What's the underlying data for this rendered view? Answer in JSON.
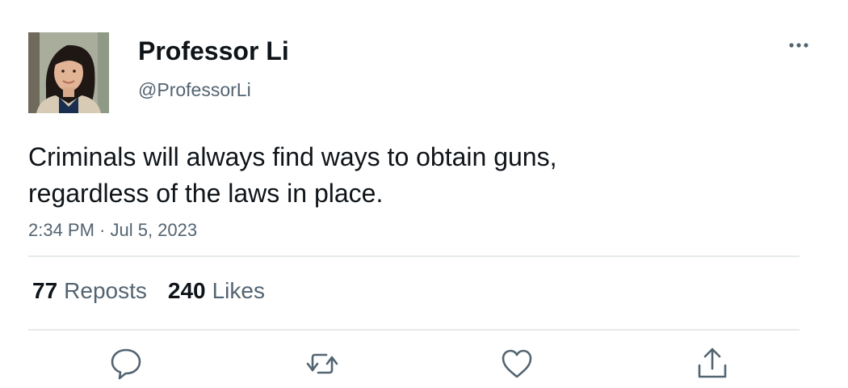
{
  "author": {
    "display_name": "Professor Li",
    "handle": "@ProfessorLi",
    "avatar_icon": "profile-photo"
  },
  "tweet": {
    "text_lines": [
      "Criminals will always find ways to obtain guns,",
      "regardless of the laws in place."
    ],
    "timestamp": "2:34 PM · Jul 5, 2023"
  },
  "stats": {
    "reposts_count": "77",
    "reposts_label": "Reposts",
    "likes_count": "240",
    "likes_label": "Likes"
  },
  "actions": [
    {
      "name": "reply",
      "icon": "speech-bubble-icon"
    },
    {
      "name": "repost",
      "icon": "repost-arrows-icon"
    },
    {
      "name": "like",
      "icon": "heart-icon"
    },
    {
      "name": "share",
      "icon": "share-upload-icon"
    }
  ],
  "colors": {
    "primary_text": "#0f1419",
    "secondary_text": "#536471",
    "divider": "#e6e9ec",
    "icon": "#536471"
  }
}
